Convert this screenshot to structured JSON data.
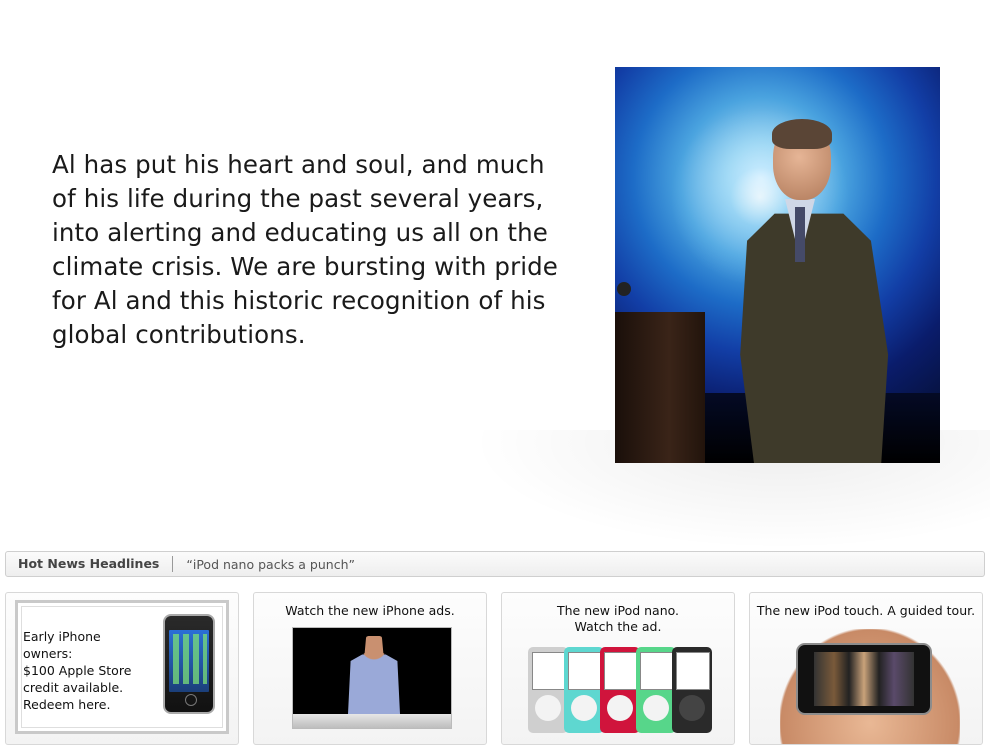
{
  "hero": {
    "quote": "Al has put his heart and soul, and much of his life during the past several years, into alerting and educating us all on the climate crisis. We are bursting with pride for Al and this historic recognition of his global contributions."
  },
  "news": {
    "label": "Hot News Headlines",
    "headline": "“iPod nano packs a punch”"
  },
  "tiles": [
    {
      "lines": [
        "Early iPhone owners:",
        "$100 Apple Store",
        "credit available.",
        "Redeem here."
      ]
    },
    {
      "title": "Watch the new iPhone ads."
    },
    {
      "title_line1": "The new iPod nano.",
      "title_line2": "Watch the ad."
    },
    {
      "title": "The new iPod touch. A guided tour."
    }
  ],
  "colors": {
    "nano_silver": "#c9c9c9",
    "nano_aqua": "#5ed7d0",
    "nano_red": "#d0143c",
    "nano_green": "#57d68a",
    "nano_black": "#2a2a2a"
  }
}
